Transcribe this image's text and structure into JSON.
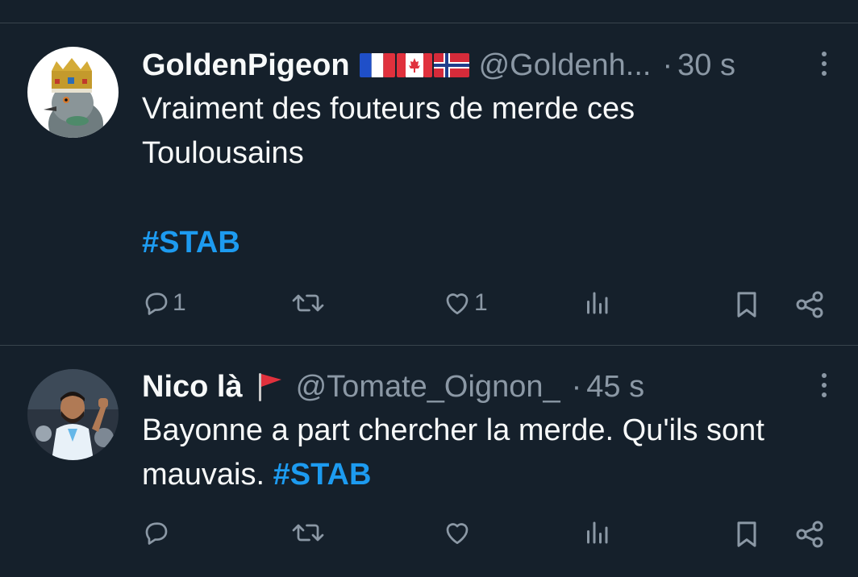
{
  "tweets": [
    {
      "display_name": "GoldenPigeon",
      "flags": [
        "flag-france-icon",
        "flag-canada-icon",
        "flag-norway-icon"
      ],
      "handle": "@Goldenh...",
      "separator": "·",
      "time": "30 s",
      "text": "Vraiment des fouteurs de merde ces Toulousains",
      "hashtag": "#STAB",
      "actions": {
        "reply_count": "1",
        "like_count": "1"
      }
    },
    {
      "display_name": "Nico là",
      "flags": [
        "red-flag-icon"
      ],
      "handle": "@Tomate_Oignon_",
      "separator": "·",
      "time": "45 s",
      "text": "Bayonne a part chercher la merde. Qu'ils sont mauvais.",
      "hashtag": "#STAB",
      "actions": {
        "reply_count": "",
        "like_count": ""
      }
    }
  ],
  "colors": {
    "background": "#15202b",
    "text": "#f7f9f9",
    "muted": "#8b98a5",
    "accent": "#1d9bf0",
    "divider": "#38444d"
  }
}
